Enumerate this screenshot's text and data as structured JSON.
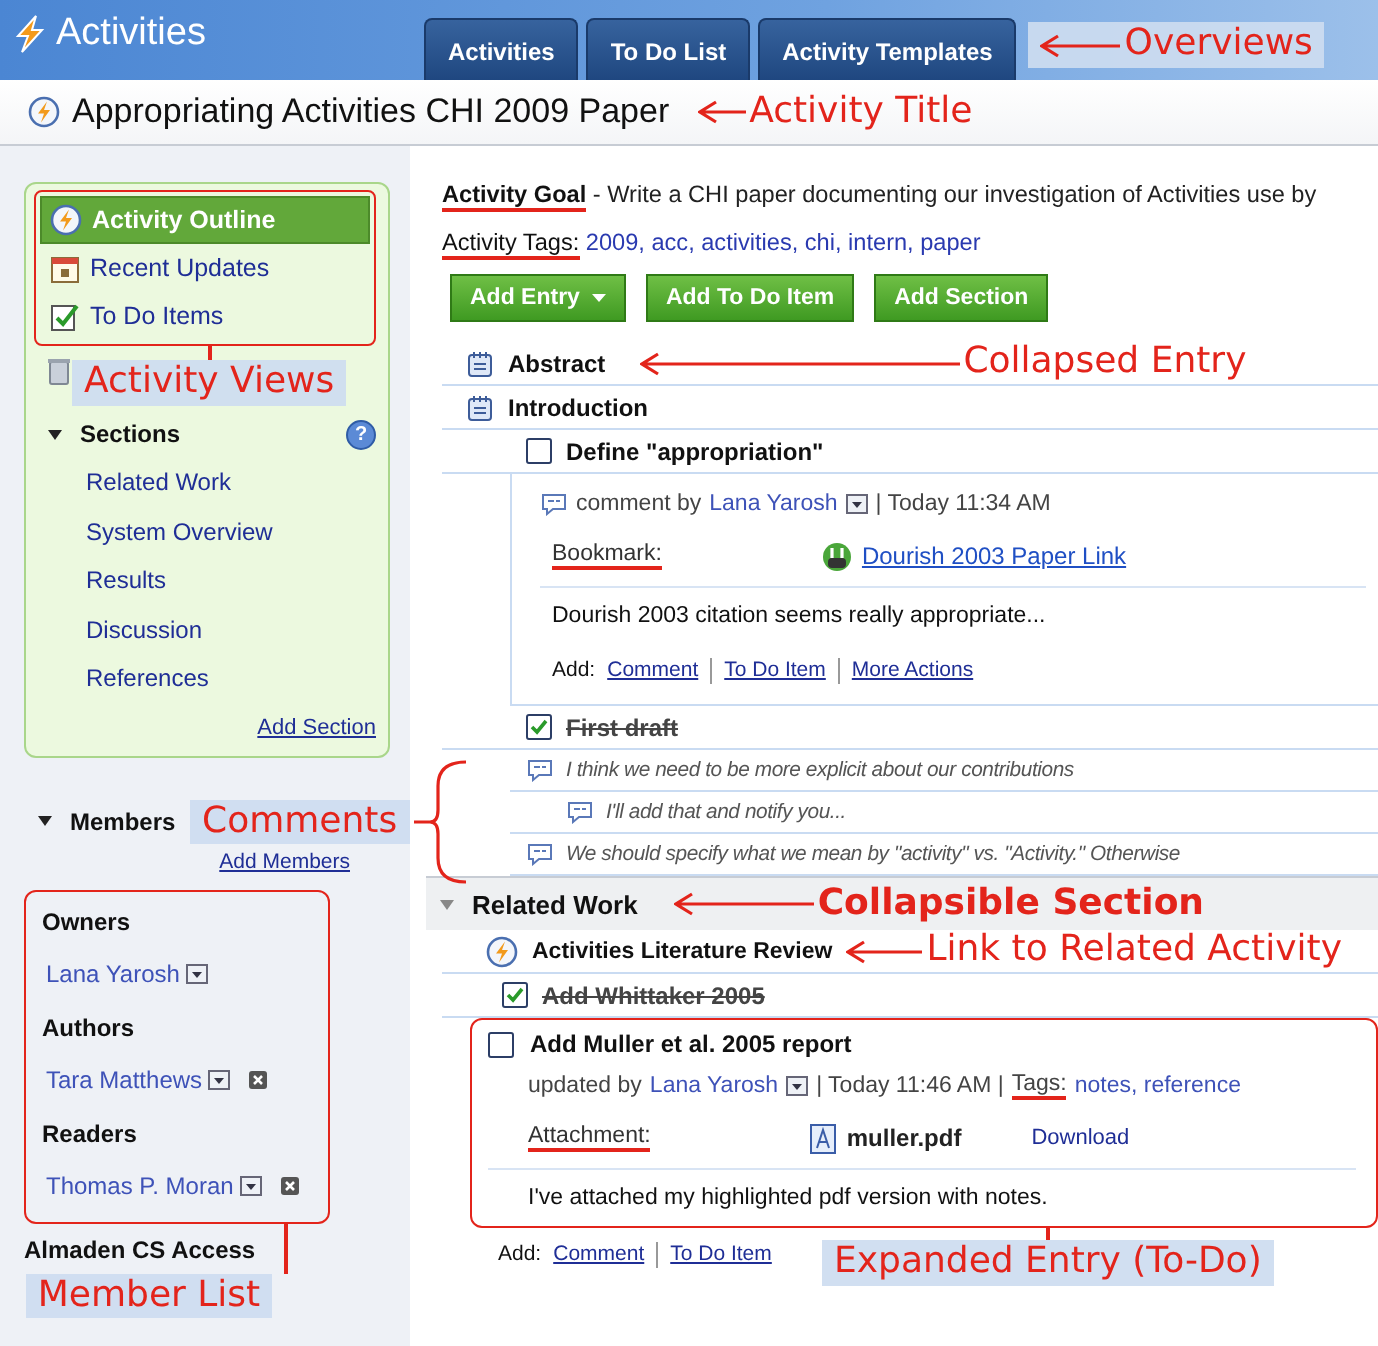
{
  "app": {
    "title": "Activities"
  },
  "tabs": [
    {
      "label": "Activities",
      "selected": false
    },
    {
      "label": "To Do List",
      "selected": false
    },
    {
      "label": "Activity Templates",
      "selected": false
    }
  ],
  "tabs_callout": "Overviews",
  "activity": {
    "title": "Appropriating Activities CHI 2009 Paper",
    "callout": "Activity Title"
  },
  "sidebar": {
    "views": {
      "annotated": true,
      "callout": "Activity Views",
      "items": [
        {
          "label": "Activity Outline",
          "selected": true
        },
        {
          "label": "Recent Updates",
          "selected": false
        },
        {
          "label": "To Do Items",
          "selected": false
        }
      ]
    },
    "sections": {
      "title": "Sections",
      "expanded": true,
      "help": "?",
      "items": [
        "Related Work",
        "System Overview",
        "Results",
        "Discussion",
        "References"
      ],
      "add_link": "Add Section"
    },
    "members": {
      "title": "Members",
      "expanded": true,
      "add_link": "Add Members",
      "annotated": true,
      "callout": "Member List",
      "groups": [
        {
          "role": "Owners",
          "members": [
            {
              "name": "Lana Yarosh",
              "removable": false
            }
          ]
        },
        {
          "role": "Authors",
          "members": [
            {
              "name": "Tara Matthews",
              "removable": true
            }
          ]
        },
        {
          "role": "Readers",
          "members": [
            {
              "name": "Thomas P. Moran",
              "removable": true
            }
          ]
        }
      ]
    },
    "access": "Almaden CS Access"
  },
  "goal": {
    "label": "Activity Goal",
    "annotated": true,
    "text": "- Write a CHI paper documenting our investigation of Activities use by"
  },
  "tags": {
    "label": "Activity Tags:",
    "annotated": true,
    "text": "2009, acc, activities, chi, intern, paper"
  },
  "buttons": [
    {
      "label": "Add Entry",
      "dropdown": true
    },
    {
      "label": "Add To Do Item",
      "dropdown": false
    },
    {
      "label": "Add Section",
      "dropdown": false
    }
  ],
  "outline": [
    {
      "kind": "entry",
      "title": "Abstract",
      "callout": "Collapsed Entry"
    },
    {
      "kind": "entry",
      "title": "Introduction",
      "children": [
        {
          "kind": "todo",
          "title": "Define \"appropriation\"",
          "checked": false,
          "detail": {
            "meta": "comment by",
            "author": "Lana Yarosh",
            "time": "| Today 11:34 AM",
            "field": {
              "kind": "bookmark",
              "label": "Bookmark:",
              "annotated": true,
              "value": "Dourish 2003 Paper Link"
            },
            "body": "Dourish 2003 citation seems really appropriate...",
            "add": {
              "label": "Add:",
              "links": [
                "Comment",
                "To Do Item",
                "More Actions"
              ]
            }
          }
        },
        {
          "kind": "todo",
          "title": "First draft",
          "checked": true,
          "comments_callout": "Comments",
          "comments": [
            {
              "text": "I think we need to be more explicit about our contributions",
              "children": [
                {
                  "text": "I'll add that and notify you..."
                }
              ]
            },
            {
              "text": "We should specify what we mean by \"activity\" vs. \"Activity.\" Otherwise"
            }
          ]
        }
      ]
    },
    {
      "kind": "section",
      "title": "Related Work",
      "expanded": true,
      "callout": "Collapsible Section",
      "children": [
        {
          "kind": "link",
          "title": "Activities Literature Review",
          "callout": "Link to Related Activity"
        },
        {
          "kind": "todo",
          "title": "Add Whittaker 2005",
          "checked": true
        },
        {
          "kind": "todo",
          "title": "Add Muller et al. 2005 report",
          "checked": false,
          "annotated": true,
          "callout": "Expanded Entry (To-Do)",
          "detail": {
            "meta": "updated by",
            "author": "Lana Yarosh",
            "time": "| Today 11:46 AM |",
            "tags_label": "Tags:",
            "tags_annotated": true,
            "tags": "notes, reference",
            "field": {
              "kind": "attachment",
              "label": "Attachment:",
              "annotated": true,
              "value": "muller.pdf",
              "action": "Download"
            },
            "body": "I've attached my highlighted pdf version with notes.",
            "add": {
              "label": "Add:",
              "links": [
                "Comment",
                "To Do Item"
              ]
            }
          }
        }
      ]
    }
  ]
}
